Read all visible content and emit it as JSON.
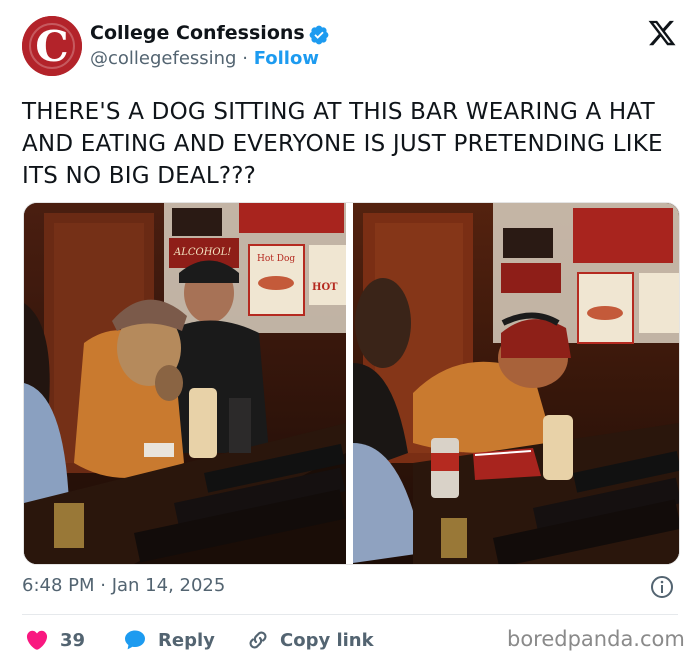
{
  "account": {
    "avatar_letter": "C",
    "name": "College Confessions",
    "handle": "@collegefessing",
    "separator": "·",
    "follow_label": "Follow",
    "verified": true
  },
  "tweet": {
    "text": "THERE'S A DOG SITTING AT THIS BAR WEARING A HAT AND EATING AND EVERYONE IS JUST PRETENDING LIKE ITS NO BIG DEAL???"
  },
  "media": {
    "photos": [
      {
        "description_icon": "photo"
      },
      {
        "description_icon": "photo"
      }
    ],
    "sign_texts": {
      "alcohol": "ALCOHOL!",
      "hot_dog": "Hot Dog",
      "hot": "HOT"
    }
  },
  "meta": {
    "timestamp": "6:48 PM · Jan 14, 2025"
  },
  "actions": {
    "like_count": "39",
    "reply_label": "Reply",
    "copy_link_label": "Copy link"
  },
  "watermark": "boredpanda.com",
  "colors": {
    "accent": "#1d9bf0",
    "like": "#f91880",
    "avatar_bg": "#b3232a",
    "text": "#0f1419",
    "muted": "#536471"
  }
}
